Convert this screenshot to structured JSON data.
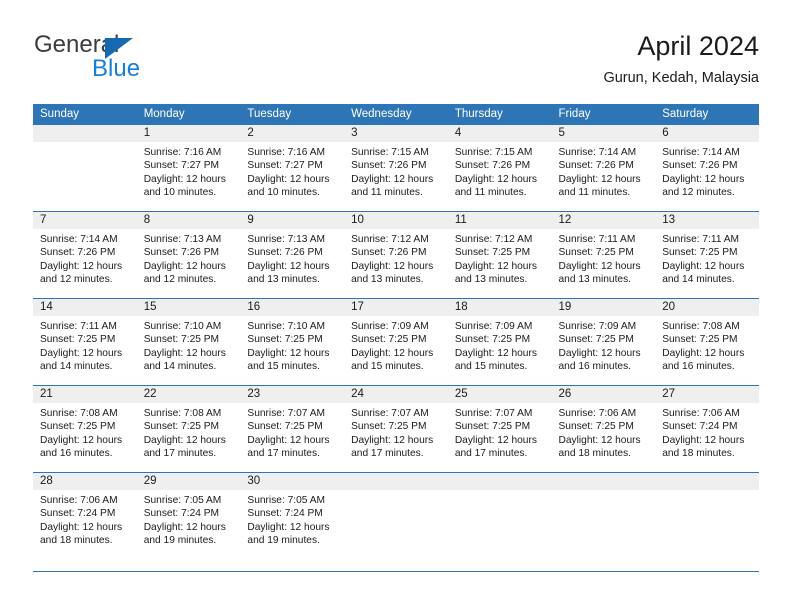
{
  "brand": {
    "name_part1": "General",
    "name_part2": "Blue",
    "triangle_color": "#1569b0",
    "blue_color": "#1a7fd4"
  },
  "header": {
    "title": "April 2024",
    "location": "Gurun, Kedah, Malaysia"
  },
  "theme": {
    "header_row_bg": "#2e75b6",
    "daynum_band_bg": "#efefef",
    "row_rule_color": "#2e75b6",
    "text_color": "#1b1b1b"
  },
  "weekday_headers": [
    "Sunday",
    "Monday",
    "Tuesday",
    "Wednesday",
    "Thursday",
    "Friday",
    "Saturday"
  ],
  "weeks": [
    [
      {
        "day": "",
        "empty": true,
        "sunrise": "",
        "sunset": "",
        "daylight_line1": "",
        "daylight_line2": ""
      },
      {
        "day": "1",
        "empty": false,
        "sunrise": "Sunrise: 7:16 AM",
        "sunset": "Sunset: 7:27 PM",
        "daylight_line1": "Daylight: 12 hours",
        "daylight_line2": "and 10 minutes."
      },
      {
        "day": "2",
        "empty": false,
        "sunrise": "Sunrise: 7:16 AM",
        "sunset": "Sunset: 7:27 PM",
        "daylight_line1": "Daylight: 12 hours",
        "daylight_line2": "and 10 minutes."
      },
      {
        "day": "3",
        "empty": false,
        "sunrise": "Sunrise: 7:15 AM",
        "sunset": "Sunset: 7:26 PM",
        "daylight_line1": "Daylight: 12 hours",
        "daylight_line2": "and 11 minutes."
      },
      {
        "day": "4",
        "empty": false,
        "sunrise": "Sunrise: 7:15 AM",
        "sunset": "Sunset: 7:26 PM",
        "daylight_line1": "Daylight: 12 hours",
        "daylight_line2": "and 11 minutes."
      },
      {
        "day": "5",
        "empty": false,
        "sunrise": "Sunrise: 7:14 AM",
        "sunset": "Sunset: 7:26 PM",
        "daylight_line1": "Daylight: 12 hours",
        "daylight_line2": "and 11 minutes."
      },
      {
        "day": "6",
        "empty": false,
        "sunrise": "Sunrise: 7:14 AM",
        "sunset": "Sunset: 7:26 PM",
        "daylight_line1": "Daylight: 12 hours",
        "daylight_line2": "and 12 minutes."
      }
    ],
    [
      {
        "day": "7",
        "empty": false,
        "sunrise": "Sunrise: 7:14 AM",
        "sunset": "Sunset: 7:26 PM",
        "daylight_line1": "Daylight: 12 hours",
        "daylight_line2": "and 12 minutes."
      },
      {
        "day": "8",
        "empty": false,
        "sunrise": "Sunrise: 7:13 AM",
        "sunset": "Sunset: 7:26 PM",
        "daylight_line1": "Daylight: 12 hours",
        "daylight_line2": "and 12 minutes."
      },
      {
        "day": "9",
        "empty": false,
        "sunrise": "Sunrise: 7:13 AM",
        "sunset": "Sunset: 7:26 PM",
        "daylight_line1": "Daylight: 12 hours",
        "daylight_line2": "and 13 minutes."
      },
      {
        "day": "10",
        "empty": false,
        "sunrise": "Sunrise: 7:12 AM",
        "sunset": "Sunset: 7:26 PM",
        "daylight_line1": "Daylight: 12 hours",
        "daylight_line2": "and 13 minutes."
      },
      {
        "day": "11",
        "empty": false,
        "sunrise": "Sunrise: 7:12 AM",
        "sunset": "Sunset: 7:25 PM",
        "daylight_line1": "Daylight: 12 hours",
        "daylight_line2": "and 13 minutes."
      },
      {
        "day": "12",
        "empty": false,
        "sunrise": "Sunrise: 7:11 AM",
        "sunset": "Sunset: 7:25 PM",
        "daylight_line1": "Daylight: 12 hours",
        "daylight_line2": "and 13 minutes."
      },
      {
        "day": "13",
        "empty": false,
        "sunrise": "Sunrise: 7:11 AM",
        "sunset": "Sunset: 7:25 PM",
        "daylight_line1": "Daylight: 12 hours",
        "daylight_line2": "and 14 minutes."
      }
    ],
    [
      {
        "day": "14",
        "empty": false,
        "sunrise": "Sunrise: 7:11 AM",
        "sunset": "Sunset: 7:25 PM",
        "daylight_line1": "Daylight: 12 hours",
        "daylight_line2": "and 14 minutes."
      },
      {
        "day": "15",
        "empty": false,
        "sunrise": "Sunrise: 7:10 AM",
        "sunset": "Sunset: 7:25 PM",
        "daylight_line1": "Daylight: 12 hours",
        "daylight_line2": "and 14 minutes."
      },
      {
        "day": "16",
        "empty": false,
        "sunrise": "Sunrise: 7:10 AM",
        "sunset": "Sunset: 7:25 PM",
        "daylight_line1": "Daylight: 12 hours",
        "daylight_line2": "and 15 minutes."
      },
      {
        "day": "17",
        "empty": false,
        "sunrise": "Sunrise: 7:09 AM",
        "sunset": "Sunset: 7:25 PM",
        "daylight_line1": "Daylight: 12 hours",
        "daylight_line2": "and 15 minutes."
      },
      {
        "day": "18",
        "empty": false,
        "sunrise": "Sunrise: 7:09 AM",
        "sunset": "Sunset: 7:25 PM",
        "daylight_line1": "Daylight: 12 hours",
        "daylight_line2": "and 15 minutes."
      },
      {
        "day": "19",
        "empty": false,
        "sunrise": "Sunrise: 7:09 AM",
        "sunset": "Sunset: 7:25 PM",
        "daylight_line1": "Daylight: 12 hours",
        "daylight_line2": "and 16 minutes."
      },
      {
        "day": "20",
        "empty": false,
        "sunrise": "Sunrise: 7:08 AM",
        "sunset": "Sunset: 7:25 PM",
        "daylight_line1": "Daylight: 12 hours",
        "daylight_line2": "and 16 minutes."
      }
    ],
    [
      {
        "day": "21",
        "empty": false,
        "sunrise": "Sunrise: 7:08 AM",
        "sunset": "Sunset: 7:25 PM",
        "daylight_line1": "Daylight: 12 hours",
        "daylight_line2": "and 16 minutes."
      },
      {
        "day": "22",
        "empty": false,
        "sunrise": "Sunrise: 7:08 AM",
        "sunset": "Sunset: 7:25 PM",
        "daylight_line1": "Daylight: 12 hours",
        "daylight_line2": "and 17 minutes."
      },
      {
        "day": "23",
        "empty": false,
        "sunrise": "Sunrise: 7:07 AM",
        "sunset": "Sunset: 7:25 PM",
        "daylight_line1": "Daylight: 12 hours",
        "daylight_line2": "and 17 minutes."
      },
      {
        "day": "24",
        "empty": false,
        "sunrise": "Sunrise: 7:07 AM",
        "sunset": "Sunset: 7:25 PM",
        "daylight_line1": "Daylight: 12 hours",
        "daylight_line2": "and 17 minutes."
      },
      {
        "day": "25",
        "empty": false,
        "sunrise": "Sunrise: 7:07 AM",
        "sunset": "Sunset: 7:25 PM",
        "daylight_line1": "Daylight: 12 hours",
        "daylight_line2": "and 17 minutes."
      },
      {
        "day": "26",
        "empty": false,
        "sunrise": "Sunrise: 7:06 AM",
        "sunset": "Sunset: 7:25 PM",
        "daylight_line1": "Daylight: 12 hours",
        "daylight_line2": "and 18 minutes."
      },
      {
        "day": "27",
        "empty": false,
        "sunrise": "Sunrise: 7:06 AM",
        "sunset": "Sunset: 7:24 PM",
        "daylight_line1": "Daylight: 12 hours",
        "daylight_line2": "and 18 minutes."
      }
    ],
    [
      {
        "day": "28",
        "empty": false,
        "sunrise": "Sunrise: 7:06 AM",
        "sunset": "Sunset: 7:24 PM",
        "daylight_line1": "Daylight: 12 hours",
        "daylight_line2": "and 18 minutes."
      },
      {
        "day": "29",
        "empty": false,
        "sunrise": "Sunrise: 7:05 AM",
        "sunset": "Sunset: 7:24 PM",
        "daylight_line1": "Daylight: 12 hours",
        "daylight_line2": "and 19 minutes."
      },
      {
        "day": "30",
        "empty": false,
        "sunrise": "Sunrise: 7:05 AM",
        "sunset": "Sunset: 7:24 PM",
        "daylight_line1": "Daylight: 12 hours",
        "daylight_line2": "and 19 minutes."
      },
      {
        "day": "",
        "empty": true,
        "sunrise": "",
        "sunset": "",
        "daylight_line1": "",
        "daylight_line2": ""
      },
      {
        "day": "",
        "empty": true,
        "sunrise": "",
        "sunset": "",
        "daylight_line1": "",
        "daylight_line2": ""
      },
      {
        "day": "",
        "empty": true,
        "sunrise": "",
        "sunset": "",
        "daylight_line1": "",
        "daylight_line2": ""
      },
      {
        "day": "",
        "empty": true,
        "sunrise": "",
        "sunset": "",
        "daylight_line1": "",
        "daylight_line2": ""
      }
    ]
  ]
}
